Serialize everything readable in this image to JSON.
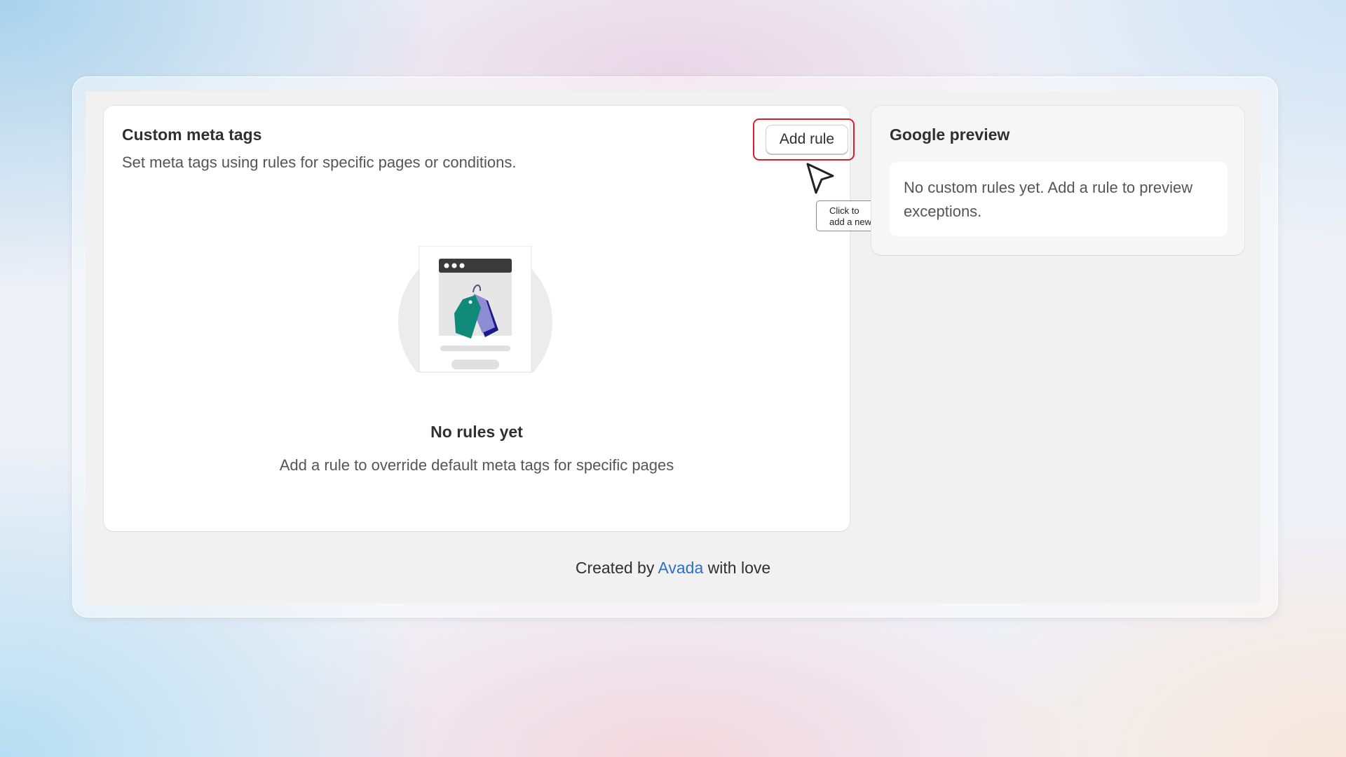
{
  "custom_meta_tags": {
    "title": "Custom meta tags",
    "subtitle": "Set meta tags using rules for specific pages or conditions.",
    "add_rule_label": "Add rule",
    "tooltip": {
      "line1": "Click to",
      "line2": "add a new rule"
    },
    "empty_state": {
      "illustration_icon": "price-tags-illustration",
      "title": "No rules yet",
      "description": "Add a rule to override default meta tags for specific pages"
    }
  },
  "google_preview": {
    "title": "Google preview",
    "message": "No custom rules yet. Add a rule to preview exceptions."
  },
  "footer": {
    "prefix": "Created by",
    "link": "Avada",
    "suffix": "with love"
  },
  "colors": {
    "highlight": "#d3202f",
    "link": "#2c6ecb",
    "tag_teal": "#0f8a78",
    "tag_purple": "#8f8cd6",
    "tag_navy": "#1a1a8c"
  }
}
